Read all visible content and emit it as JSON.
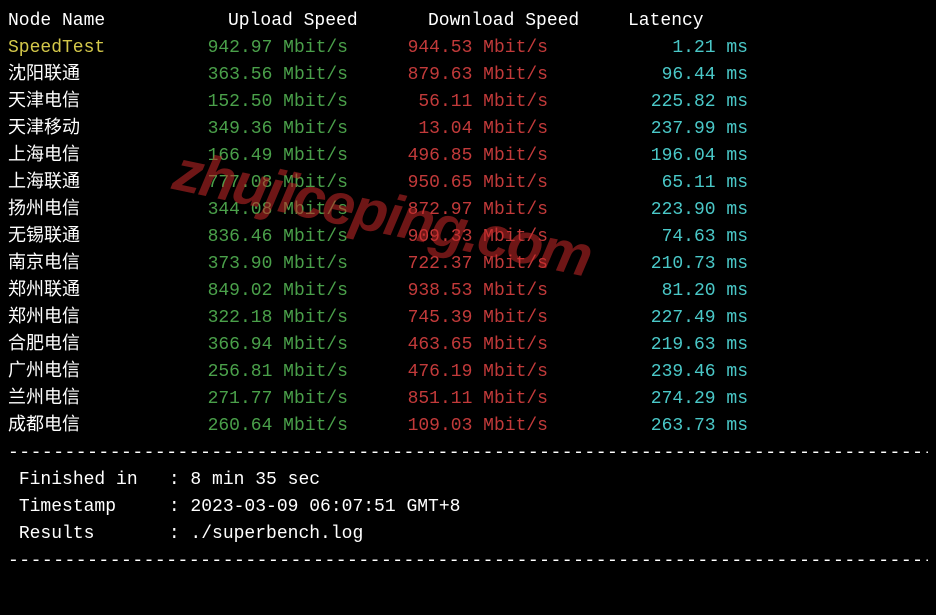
{
  "header": {
    "node": "Node Name",
    "upload": "Upload Speed",
    "download": "Download Speed",
    "latency": "Latency"
  },
  "speedtest_row": {
    "node": "SpeedTest",
    "upload": "942.97 Mbit/s",
    "download": "944.53 Mbit/s",
    "latency": "1.21 ms"
  },
  "rows": [
    {
      "node": "沈阳联通",
      "upload": "363.56 Mbit/s",
      "download": "879.63 Mbit/s",
      "latency": "96.44 ms"
    },
    {
      "node": "天津电信",
      "upload": "152.50 Mbit/s",
      "download": "56.11 Mbit/s",
      "latency": "225.82 ms"
    },
    {
      "node": "天津移动",
      "upload": "349.36 Mbit/s",
      "download": "13.04 Mbit/s",
      "latency": "237.99 ms"
    },
    {
      "node": "上海电信",
      "upload": "166.49 Mbit/s",
      "download": "496.85 Mbit/s",
      "latency": "196.04 ms"
    },
    {
      "node": "上海联通",
      "upload": "777.08 Mbit/s",
      "download": "950.65 Mbit/s",
      "latency": "65.11 ms"
    },
    {
      "node": "扬州电信",
      "upload": "344.08 Mbit/s",
      "download": "872.97 Mbit/s",
      "latency": "223.90 ms"
    },
    {
      "node": "无锡联通",
      "upload": "836.46 Mbit/s",
      "download": "909.33 Mbit/s",
      "latency": "74.63 ms"
    },
    {
      "node": "南京电信",
      "upload": "373.90 Mbit/s",
      "download": "722.37 Mbit/s",
      "latency": "210.73 ms"
    },
    {
      "node": "郑州联通",
      "upload": "849.02 Mbit/s",
      "download": "938.53 Mbit/s",
      "latency": "81.20 ms"
    },
    {
      "node": "郑州电信",
      "upload": "322.18 Mbit/s",
      "download": "745.39 Mbit/s",
      "latency": "227.49 ms"
    },
    {
      "node": "合肥电信",
      "upload": "366.94 Mbit/s",
      "download": "463.65 Mbit/s",
      "latency": "219.63 ms"
    },
    {
      "node": "广州电信",
      "upload": "256.81 Mbit/s",
      "download": "476.19 Mbit/s",
      "latency": "239.46 ms"
    },
    {
      "node": "兰州电信",
      "upload": "271.77 Mbit/s",
      "download": "851.11 Mbit/s",
      "latency": "274.29 ms"
    },
    {
      "node": "成都电信",
      "upload": "260.64 Mbit/s",
      "download": "109.03 Mbit/s",
      "latency": "263.73 ms"
    }
  ],
  "footer": {
    "finished_label": "Finished in",
    "finished_value": "8 min 35 sec",
    "timestamp_label": "Timestamp",
    "timestamp_value": "2023-03-09 06:07:51 GMT+8",
    "results_label": "Results",
    "results_value": "./superbench.log"
  },
  "divider": "----------------------------------------------------------------------------------",
  "watermark": "zhujiceping.com"
}
